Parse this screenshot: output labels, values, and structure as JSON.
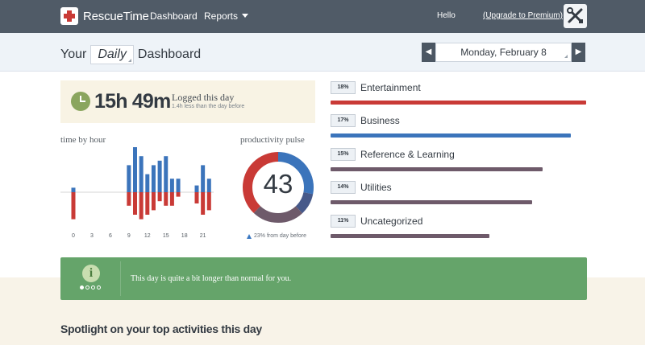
{
  "topbar": {
    "app_name": "RescueTime",
    "nav_dashboard": "Dashboard",
    "nav_reports": "Reports",
    "hello": "Hello",
    "upgrade_link": "(Upgrade to Premium)",
    "tools_icon": "tools-icon"
  },
  "header": {
    "title_prefix": "Your",
    "period": "Daily",
    "title_suffix": "Dashboard",
    "date": "Monday, February 8"
  },
  "logged": {
    "time": "15h 49m",
    "label": "Logged this day",
    "sub": "1.4h less than the day before"
  },
  "time_by_hour": {
    "label": "time by hour",
    "tick_labels": [
      "0",
      "3",
      "6",
      "9",
      "12",
      "15",
      "18",
      "21"
    ],
    "colors": {
      "productive": "#3b74bb",
      "distracting": "#c93a36"
    },
    "chart_data": {
      "type": "bar",
      "x": [
        0,
        9,
        10,
        11,
        12,
        13,
        14,
        15,
        16,
        17,
        20,
        21,
        22
      ],
      "productive": [
        0.1,
        0.6,
        1.0,
        0.8,
        0.4,
        0.6,
        0.7,
        0.8,
        0.3,
        0.3,
        0.15,
        0.6,
        0.3
      ],
      "distracting": [
        0.6,
        0.3,
        0.5,
        0.6,
        0.5,
        0.4,
        0.2,
        0.3,
        0.3,
        0.1,
        0.25,
        0.5,
        0.4
      ]
    }
  },
  "pulse": {
    "label": "productivity pulse",
    "score": "43",
    "change": "23% from day before",
    "segments": [
      {
        "fraction": 0.28,
        "color": "#3b74bb"
      },
      {
        "fraction": 0.1,
        "color": "#46598a"
      },
      {
        "fraction": 0.24,
        "color": "#6e5a6a"
      },
      {
        "fraction": 0.38,
        "color": "#c93a36"
      }
    ]
  },
  "categories": [
    {
      "pct": "18%",
      "name": "Entertainment",
      "fraction": 1.0,
      "color": "#c93a36"
    },
    {
      "pct": "17%",
      "name": "Business",
      "fraction": 0.94,
      "color": "#3b74bb"
    },
    {
      "pct": "15%",
      "name": "Reference & Learning",
      "fraction": 0.83,
      "color": "#6e5a6a"
    },
    {
      "pct": "14%",
      "name": "Utilities",
      "fraction": 0.79,
      "color": "#6e5a6a"
    },
    {
      "pct": "11%",
      "name": "Uncategorized",
      "fraction": 0.62,
      "color": "#6e5a6a"
    }
  ],
  "notice": {
    "text": "This day is quite a bit longer than normal for you.",
    "icon": "info-icon",
    "dots_total": 4,
    "dots_active": 1
  },
  "spotlight_title": "Spotlight on your top activities this day"
}
